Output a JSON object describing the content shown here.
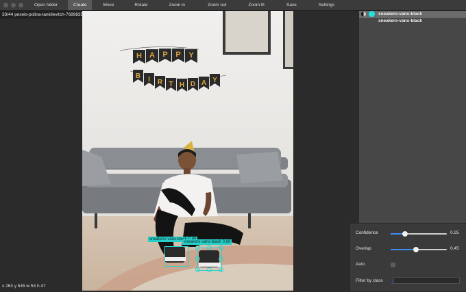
{
  "toolbar": {
    "buttons": [
      {
        "label": "Open folder",
        "active": false
      },
      {
        "label": "Create",
        "active": true
      },
      {
        "label": "Move",
        "active": false
      },
      {
        "label": "Rotate",
        "active": false
      },
      {
        "label": "Zoom in",
        "active": false
      },
      {
        "label": "Zoom out",
        "active": false
      },
      {
        "label": "Zoom fit",
        "active": false
      },
      {
        "label": "Save",
        "active": false
      },
      {
        "label": "Settings",
        "active": false
      }
    ]
  },
  "image_info": "33/44 pexels-polina-tankilevitch-7689835.jpg w 482px h 640px",
  "cursor_info": "x 263 y 545 w 53 h 47",
  "photo": {
    "banner_letters_row1": [
      "H",
      "A",
      "P",
      "P",
      "Y"
    ],
    "banner_letters_row2": [
      "B",
      "I",
      "R",
      "T",
      "H",
      "D",
      "A",
      "Y"
    ]
  },
  "annotations": [
    {
      "label": "sneakers-vans-black 0.89",
      "color": "#2ad4cf"
    },
    {
      "label": "sneakers-vans-black 0.89",
      "color": "#2ad4cf"
    }
  ],
  "labels": [
    {
      "name": "sneakers-vans-black",
      "selected": true,
      "color": "#1fe3e3"
    },
    {
      "name": "sneakers-vans-black",
      "selected": false
    }
  ],
  "settings": {
    "confidence_label": "Confidence",
    "confidence_value": "0.25",
    "confidence": 0.25,
    "overlap_label": "Overlap",
    "overlap_value": "0.45",
    "overlap": 0.45,
    "auto_label": "Auto",
    "auto_checked": false,
    "filter_label": "Filter by class",
    "filter_value": ""
  }
}
